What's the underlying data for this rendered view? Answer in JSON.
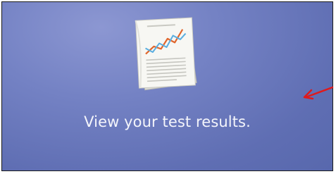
{
  "tile": {
    "caption": "View your test results.",
    "icon": "test-results-document-icon",
    "background_color": "#6674ba",
    "caption_color": "#f4f5fb"
  },
  "annotation": {
    "icon": "red-arrow-icon",
    "color": "#e0191b"
  }
}
